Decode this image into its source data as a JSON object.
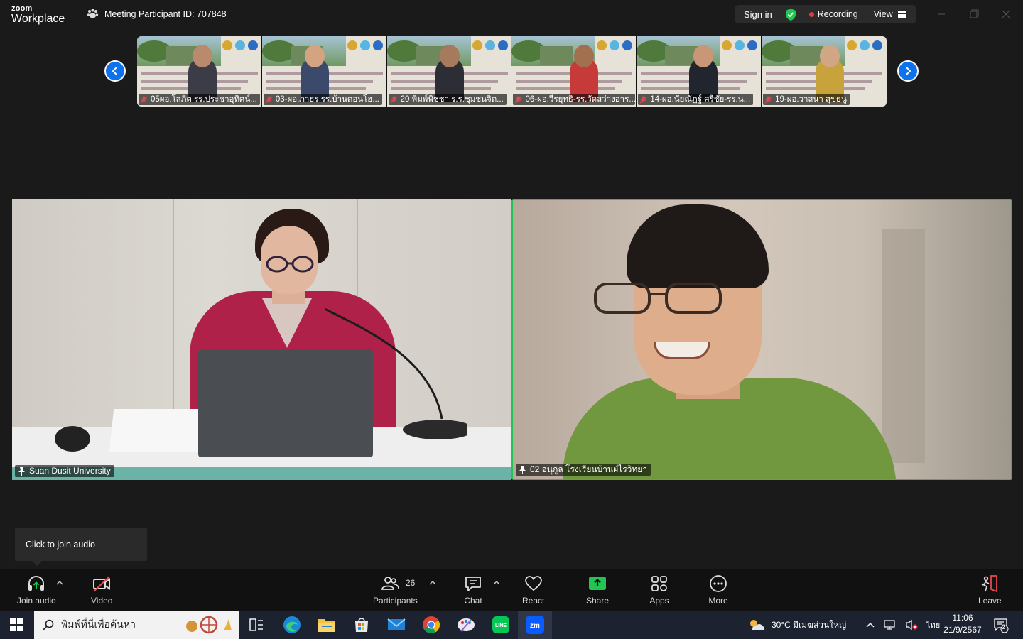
{
  "titlebar": {
    "brand_small": "zoom",
    "brand_large": "Workplace",
    "meeting_id": "Meeting Participant ID: 707848",
    "sign_in": "Sign in",
    "recording": "Recording",
    "view": "View"
  },
  "thumbnails": [
    {
      "name": "05ผอ.โสภิต  รร.ประชาอุทิศน์...",
      "tie": "#3c3c46"
    },
    {
      "name": "03-ผอ.ภาธร รร.บ้านดอนโฮ...",
      "tie": "#3b4a6a"
    },
    {
      "name": "20 พิมพ์พิชชา ร.ร.ชุมชนจิต...",
      "tie": "#2d2d36"
    },
    {
      "name": "06-ผอ.วีรยุทธิ-รร.วัดสว่างอาร...",
      "tie": "#c73a3a"
    },
    {
      "name": "14-ผอ.นัยณัฎฐ์ ศรีชัย-รร.น...",
      "tie": "#20252e"
    },
    {
      "name": "19-ผอ.วาสนา สุขธนู",
      "tie": "#c8a23a"
    }
  ],
  "videos": [
    {
      "name": "Suan Dusit University"
    },
    {
      "name": "02 อนุกูล โรงเรียนบ้านฝ่ไรวิทยา"
    }
  ],
  "toast": {
    "text": "Click to join audio"
  },
  "toolbar": {
    "join_audio": "Join audio",
    "video": "Video",
    "participants": "Participants",
    "participants_count": "26",
    "chat": "Chat",
    "react": "React",
    "share": "Share",
    "apps": "Apps",
    "more": "More",
    "leave": "Leave"
  },
  "taskbar": {
    "search_placeholder": "พิมพ์ที่นี่เพื่อค้นหา",
    "weather": "30°C  มีเมฆส่วนใหญ่",
    "language": "ไทย",
    "time": "11:06",
    "date": "21/9/2567",
    "notifications": "2"
  },
  "colors": {
    "accent_blue": "#0e72ed",
    "active_speaker": "#23c552",
    "share_green": "#23c552",
    "leave_red": "#e5484d"
  }
}
